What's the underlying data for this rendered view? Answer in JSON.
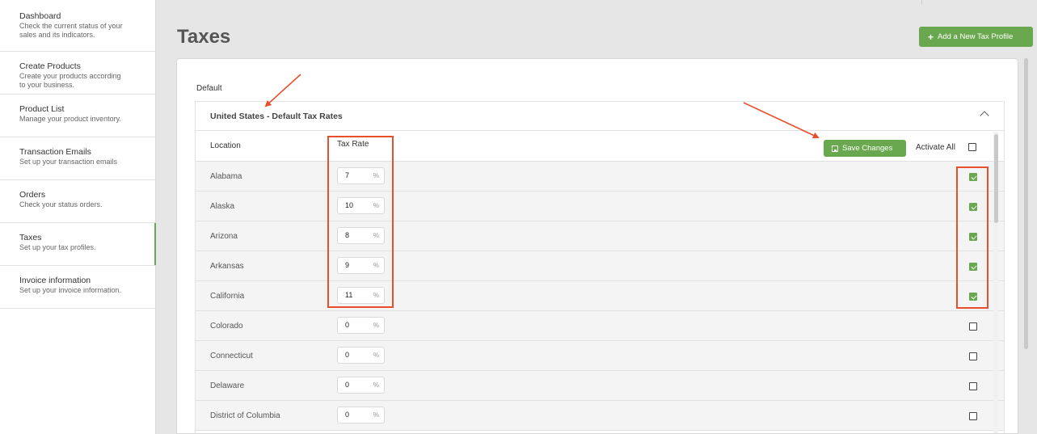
{
  "sidebar": {
    "items": [
      {
        "title": "Dashboard",
        "desc": "Check the current status of your\nsales and its indicators."
      },
      {
        "title": "Create Products",
        "desc": "Create your products according\nto your business."
      },
      {
        "title": "Product List",
        "desc": "Manage your product inventory."
      },
      {
        "title": "Transaction Emails",
        "desc": "Set up your transaction emails"
      },
      {
        "title": "Orders",
        "desc": "Check your status orders."
      },
      {
        "title": "Taxes",
        "desc": "Set up your tax profiles."
      },
      {
        "title": "Invoice information",
        "desc": "Set up your invoice information."
      }
    ],
    "active": "Taxes"
  },
  "header": {
    "title": "Taxes",
    "add_button": "Add a New Tax Profile"
  },
  "card": {
    "section_label": "Default",
    "panel_title": "United States - Default Tax Rates",
    "columns": {
      "location": "Location",
      "rate": "Tax Rate"
    },
    "save_button": "Save Changes",
    "activate_all": "Activate All",
    "percent_symbol": "%",
    "rows": [
      {
        "location": "Alabama",
        "rate": "7",
        "active": true
      },
      {
        "location": "Alaska",
        "rate": "10",
        "active": true
      },
      {
        "location": "Arizona",
        "rate": "8",
        "active": true
      },
      {
        "location": "Arkansas",
        "rate": "9",
        "active": true
      },
      {
        "location": "California",
        "rate": "11",
        "active": true
      },
      {
        "location": "Colorado",
        "rate": "0",
        "active": false
      },
      {
        "location": "Connecticut",
        "rate": "0",
        "active": false
      },
      {
        "location": "Delaware",
        "rate": "0",
        "active": false
      },
      {
        "location": "District of Columbia",
        "rate": "0",
        "active": false
      }
    ]
  },
  "colors": {
    "accent_green": "#6aa84f",
    "annotation_red": "#e8502d"
  },
  "icons": [
    "plus-icon",
    "save-icon",
    "chevron-up-icon",
    "checkbox-icon"
  ]
}
